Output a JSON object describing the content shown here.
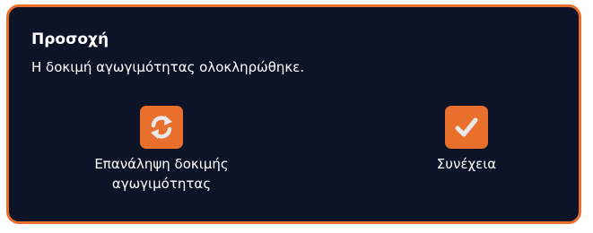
{
  "dialog": {
    "title": "Προσοχή",
    "message": "Η δοκιμή αγωγιμότητας ολοκληρώθηκε."
  },
  "actions": {
    "retry": {
      "label_line1": "Επανάληψη δοκιμής",
      "label_line2": "αγωγιμότητας",
      "icon": "refresh-icon"
    },
    "continue": {
      "label": "Συνέχεια",
      "icon": "checkmark-icon"
    }
  },
  "colors": {
    "background": "#0d1428",
    "accent": "#e8702c",
    "text": "#ffffff",
    "icon_light": "#e8e8e8"
  }
}
